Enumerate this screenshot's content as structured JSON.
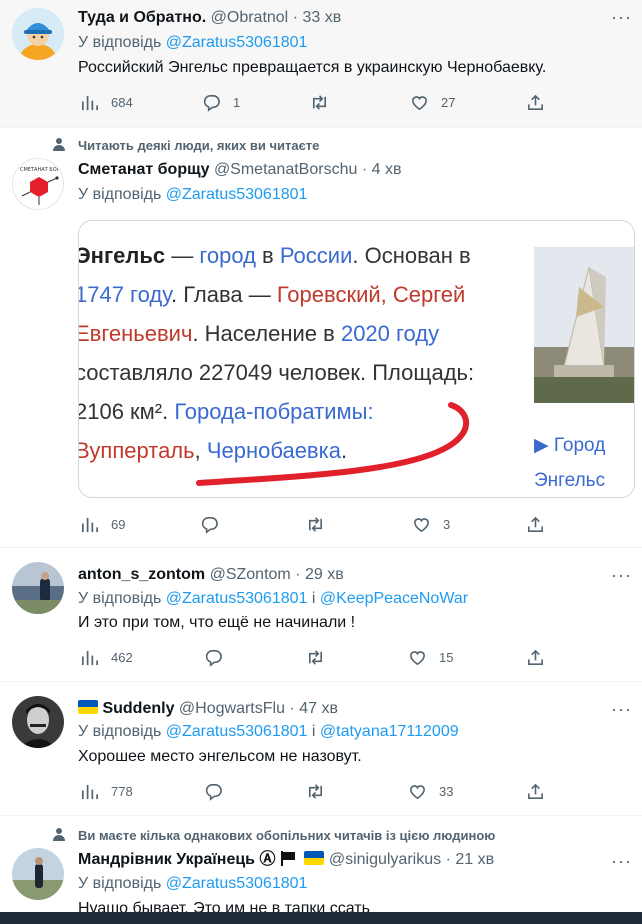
{
  "tweets": [
    {
      "name": "Туда и Обратно.",
      "handle": "@Obratnol",
      "time": "33 хв",
      "reply_prefix": "У відповідь",
      "mention1": "@Zaratus53061801",
      "text": "Российский Энгельс превращается в украинскую Чернобаевку.",
      "views": "684",
      "replies": "1",
      "retweets": "",
      "likes": "27"
    },
    {
      "social_context": "Читають деякі люди, яких ви читаєте",
      "name": "Сметанат борщу",
      "handle": "@SmetanatBorschu",
      "time": "4 хв",
      "reply_prefix": "У відповідь",
      "mention1": "@Zaratus53061801",
      "media": {
        "line1_a": "Энгельс",
        "line1_b": " — ",
        "line1_c": "город",
        "line1_d": " в ",
        "line1_e": "России",
        "line1_f": ". Основан в",
        "line2_a": "1747 году",
        "line2_b": ". Глава — ",
        "line2_c": "Горевский, Сергей",
        "line3_a": "Евгеньевич",
        "line3_b": ". Население в ",
        "line3_c": "2020 году",
        "line4": "составляло 227049 человек. Площадь:",
        "line5_a": "2106 км². ",
        "line5_b": "Города-побратимы:",
        "line6_a": "Вупперталь",
        "line6_b": ", ",
        "line6_c": "Чернобаевка",
        "line6_d": ".",
        "link_line1": "▶ Город",
        "link_line2": "Энгельс"
      },
      "views": "69",
      "replies": "",
      "retweets": "",
      "likes": "3"
    },
    {
      "name": "anton_s_zontom",
      "handle": "@SZontom",
      "time": "29 хв",
      "reply_prefix": "У відповідь",
      "mention1": "@Zaratus53061801",
      "joiner": "і",
      "mention2": "@KeepPeaceNoWar",
      "text": "И это при том, что ещё не начинали !",
      "views": "462",
      "replies": "",
      "retweets": "",
      "likes": "15"
    },
    {
      "name": "Suddenly",
      "handle": "@HogwartsFlu",
      "time": "47 хв",
      "reply_prefix": "У відповідь",
      "mention1": "@Zaratus53061801",
      "joiner": "і",
      "mention2": "@tatyana17112009",
      "text": "Хорошее место энгельсом не назовут.",
      "views": "778",
      "replies": "",
      "retweets": "",
      "likes": "33"
    },
    {
      "social_context": "Ви маєте кілька однакових обопільних читачів із цією людиною",
      "name": "Мандрівник Українець Ⓐ",
      "handle": "@sinigulyarikus",
      "time": "21 хв",
      "reply_prefix": "У відповідь",
      "mention1": "@Zaratus53061801",
      "text": "Нуашо бывает. Это им не в тапки ссать"
    }
  ],
  "separator_dot": "·",
  "more_glyph": "···",
  "colors": {
    "link": "#1d9bf0",
    "secondary": "#536471",
    "wiki_link": "#3a6ad0",
    "wiki_red_link": "#c0392b",
    "annotation": "#e0202a"
  }
}
